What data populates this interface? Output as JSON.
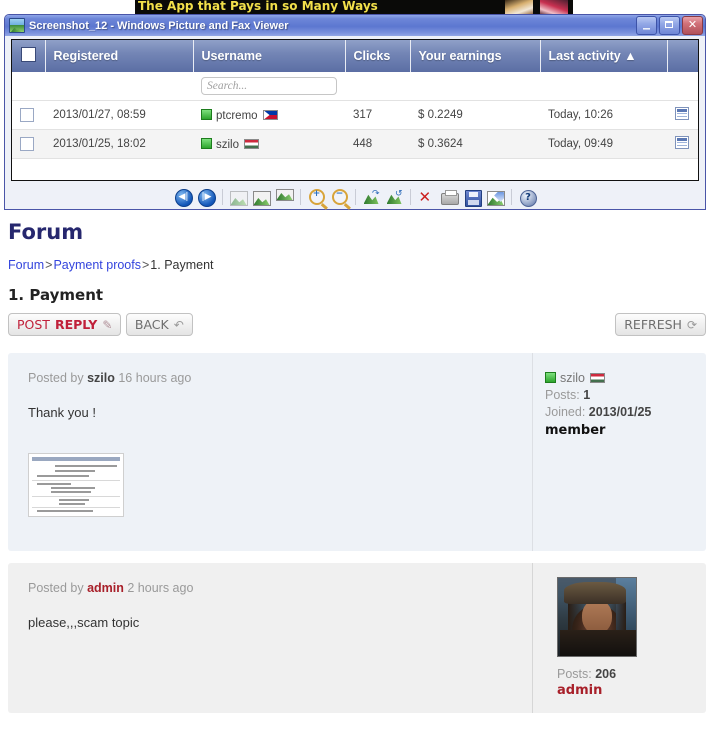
{
  "banner": {
    "text": "The App that Pays in so Many Ways"
  },
  "viewer": {
    "title": "Screenshot_12 - Windows Picture and Fax Viewer",
    "app_icon": "picture-icon",
    "window_controls": {
      "minimize": "_",
      "maximize": "maximize-icon",
      "close": "✕"
    },
    "table": {
      "columns": [
        "",
        "Registered",
        "Username",
        "Clicks",
        "Your earnings",
        "Last activity ▲",
        ""
      ],
      "sort_column": "Last activity",
      "sort_direction": "ascending",
      "search_placeholder": "Search...",
      "search_value": "",
      "rows": [
        {
          "checked": false,
          "registered": "2013/01/27, 08:59",
          "username": "ptcremo",
          "status": "online",
          "flag": "philippines-flag",
          "clicks": "317",
          "earnings": "$ 0.2249",
          "last_activity": "Today, 10:26"
        },
        {
          "checked": false,
          "registered": "2013/01/25, 18:02",
          "username": "szilo",
          "status": "online",
          "flag": "hungary-flag",
          "clicks": "448",
          "earnings": "$ 0.3624",
          "last_activity": "Today, 09:49"
        }
      ]
    },
    "toolbar_icons": [
      "previous-image-icon",
      "next-image-icon",
      "best-fit-icon",
      "actual-size-icon",
      "start-slideshow-icon",
      "zoom-in-icon",
      "zoom-out-icon",
      "rotate-clockwise-icon",
      "rotate-counterclockwise-icon",
      "delete-icon",
      "print-icon",
      "save-icon",
      "edit-icon",
      "help-icon"
    ]
  },
  "forum": {
    "heading": "Forum",
    "breadcrumb": {
      "root": "Forum",
      "section": "Payment proofs",
      "current": "1. Payment",
      "separator": ">"
    },
    "topic_title": "1. Payment",
    "buttons": {
      "post_reply_a": "POST ",
      "post_reply_b": "REPLY",
      "post_reply_icon": "✎",
      "back": "BACK",
      "back_icon": "↶",
      "refresh": "REFRESH",
      "refresh_icon": "⟳"
    },
    "posts": [
      {
        "posted_by_label": "Posted by",
        "author": "szilo",
        "time": "16 hours ago",
        "body": "Thank you !",
        "has_attachment": true,
        "attachment": "payment-receipt-thumbnail",
        "sidebar": {
          "name": "szilo",
          "status": "online",
          "flag": "hungary-flag",
          "posts_label": "Posts:",
          "posts_count": "1",
          "joined_label": "Joined:",
          "joined_date": "2013/01/25",
          "rank": "member"
        }
      },
      {
        "posted_by_label": "Posted by",
        "author": "admin",
        "time": "2 hours ago",
        "body": "please,,,scam topic",
        "has_attachment": false,
        "sidebar": {
          "avatar": "jack-sparrow-avatar",
          "posts_label": "Posts:",
          "posts_count": "206",
          "rank": "admin"
        }
      }
    ]
  },
  "colors": {
    "title_bar": "#5c77d0",
    "table_header": "#7486b6",
    "forum_heading": "#26276e",
    "link": "#3344dd",
    "accent_red": "#c0203a",
    "admin_red": "#a8202a",
    "online_green": "#2ea52e"
  }
}
